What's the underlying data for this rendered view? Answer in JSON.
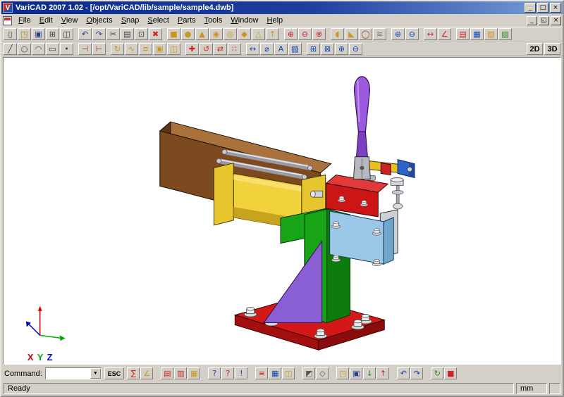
{
  "window": {
    "title": "VariCAD 2007 1.02 - [/opt/VariCAD/lib/sample/sample4.dwb]",
    "app_icon_glyph": "V",
    "controls": [
      {
        "name": "minimize-button",
        "glyph": "_"
      },
      {
        "name": "maximize-button",
        "glyph": "□"
      },
      {
        "name": "close-button",
        "glyph": "×"
      }
    ],
    "mdi_controls": [
      {
        "name": "mdi-minimize-button",
        "glyph": "_"
      },
      {
        "name": "mdi-restore-button",
        "glyph": "◱"
      },
      {
        "name": "mdi-close-button",
        "glyph": "×"
      }
    ]
  },
  "menubar": {
    "items": [
      "File",
      "Edit",
      "View",
      "Objects",
      "Snap",
      "Select",
      "Parts",
      "Tools",
      "Window",
      "Help"
    ]
  },
  "toolbars": {
    "label_2d": "2D",
    "label_3d": "3D",
    "row1": [
      [
        {
          "name": "new-document-icon",
          "glyph": "▯",
          "color": "#404040"
        },
        {
          "name": "open-file-icon",
          "glyph": "◳",
          "color": "#b8860b"
        },
        {
          "name": "save-icon",
          "glyph": "▣",
          "color": "#27408b"
        },
        {
          "name": "print-icon",
          "glyph": "⊞",
          "color": "#404040"
        },
        {
          "name": "print-preview-icon",
          "glyph": "◫",
          "color": "#404040"
        }
      ],
      [
        {
          "name": "undo-icon",
          "glyph": "↶",
          "color": "#1133aa"
        },
        {
          "name": "redo-icon",
          "glyph": "↷",
          "color": "#1133aa"
        },
        {
          "name": "cut-icon",
          "glyph": "✂",
          "color": "#404040"
        },
        {
          "name": "copy-icon",
          "glyph": "▤",
          "color": "#404040"
        },
        {
          "name": "paste-icon",
          "glyph": "⊡",
          "color": "#404040"
        },
        {
          "name": "delete-icon",
          "glyph": "✖",
          "color": "#cc2222"
        }
      ],
      [
        {
          "name": "solid-box-icon",
          "glyph": "■",
          "color": "#c8961e"
        },
        {
          "name": "solid-cylinder-icon",
          "glyph": "●",
          "color": "#c8961e"
        },
        {
          "name": "solid-cone-icon",
          "glyph": "▲",
          "color": "#c8961e"
        },
        {
          "name": "solid-sphere-icon",
          "glyph": "◉",
          "color": "#c8961e"
        },
        {
          "name": "solid-torus-icon",
          "glyph": "◎",
          "color": "#c8961e"
        },
        {
          "name": "solid-prism-icon",
          "glyph": "◆",
          "color": "#c8961e"
        },
        {
          "name": "solid-pyramid-icon",
          "glyph": "△",
          "color": "#c8961e"
        },
        {
          "name": "solid-extrude-icon",
          "glyph": "↑",
          "color": "#c8961e"
        }
      ],
      [
        {
          "name": "boolean-union-icon",
          "glyph": "⊕",
          "color": "#cc2222"
        },
        {
          "name": "boolean-subtract-icon",
          "glyph": "⊖",
          "color": "#cc2222"
        },
        {
          "name": "boolean-intersect-icon",
          "glyph": "⊗",
          "color": "#cc2222"
        }
      ],
      [
        {
          "name": "fillet-icon",
          "glyph": "◖",
          "color": "#c8961e"
        },
        {
          "name": "chamfer-icon",
          "glyph": "◣",
          "color": "#c8961e"
        },
        {
          "name": "hole-icon",
          "glyph": "◯",
          "color": "#8a4b1e"
        },
        {
          "name": "thread-icon",
          "glyph": "≋",
          "color": "#777777"
        }
      ],
      [
        {
          "name": "zoom-in-icon",
          "glyph": "⊕",
          "color": "#1144bb"
        },
        {
          "name": "zoom-out-icon",
          "glyph": "⊖",
          "color": "#1144bb"
        }
      ],
      [
        {
          "name": "measure-distance-icon",
          "glyph": "↔",
          "color": "#cc2222"
        },
        {
          "name": "measure-angle-icon",
          "glyph": "∠",
          "color": "#cc2222"
        }
      ],
      [
        {
          "name": "layers-icon",
          "glyph": "▤",
          "color": "#cc2222"
        },
        {
          "name": "grid-icon",
          "glyph": "▦",
          "color": "#1144bb"
        },
        {
          "name": "snap-settings-icon",
          "glyph": "▧",
          "color": "#c8961e"
        },
        {
          "name": "display-settings-icon",
          "glyph": "▨",
          "color": "#2a8a2a"
        }
      ]
    ],
    "row2": [
      [
        {
          "name": "line-icon",
          "glyph": "╱",
          "color": "#404040"
        },
        {
          "name": "circle-icon",
          "glyph": "○",
          "color": "#404040"
        },
        {
          "name": "arc-icon",
          "glyph": "◠",
          "color": "#404040"
        },
        {
          "name": "rectangle-icon",
          "glyph": "▭",
          "color": "#404040"
        },
        {
          "name": "point-icon",
          "glyph": "•",
          "color": "#404040"
        }
      ],
      [
        {
          "name": "trim-icon",
          "glyph": "⊣",
          "color": "#aa3322"
        },
        {
          "name": "extend-icon",
          "glyph": "⊢",
          "color": "#aa3322"
        }
      ],
      [
        {
          "name": "revolve-icon",
          "glyph": "↻",
          "color": "#c8961e"
        },
        {
          "name": "sweep-icon",
          "glyph": "∿",
          "color": "#c8961e"
        },
        {
          "name": "loft-icon",
          "glyph": "≡",
          "color": "#c8961e"
        },
        {
          "name": "shell-icon",
          "glyph": "▣",
          "color": "#c8961e"
        },
        {
          "name": "rib-icon",
          "glyph": "◫",
          "color": "#c8961e"
        }
      ],
      [
        {
          "name": "move-icon",
          "glyph": "✚",
          "color": "#cc2222"
        },
        {
          "name": "rotate-icon",
          "glyph": "↺",
          "color": "#cc2222"
        },
        {
          "name": "mirror-icon",
          "glyph": "⇄",
          "color": "#cc2222"
        },
        {
          "name": "pattern-icon",
          "glyph": "∷",
          "color": "#cc2222"
        }
      ],
      [
        {
          "name": "dimension-icon",
          "glyph": "↔",
          "color": "#1144bb"
        },
        {
          "name": "diameter-icon",
          "glyph": "⌀",
          "color": "#1144bb"
        },
        {
          "name": "text-icon",
          "glyph": "A",
          "color": "#1144bb"
        },
        {
          "name": "hatch-icon",
          "glyph": "▨",
          "color": "#1144bb"
        }
      ],
      [
        {
          "name": "zoom-window-icon",
          "glyph": "⊞",
          "color": "#1144bb"
        },
        {
          "name": "zoom-all-icon",
          "glyph": "⊠",
          "color": "#1144bb"
        },
        {
          "name": "zoom-in-2-icon",
          "glyph": "⊕",
          "color": "#1144bb"
        },
        {
          "name": "zoom-out-2-icon",
          "glyph": "⊖",
          "color": "#1144bb"
        }
      ]
    ]
  },
  "command_bar": {
    "label": "Command:",
    "esc": "ESC",
    "groups": [
      [
        {
          "name": "calculator-icon",
          "glyph": "∑",
          "color": "#cc2222"
        },
        {
          "name": "angle-tool-icon",
          "glyph": "∠",
          "color": "#c8961e"
        }
      ],
      [
        {
          "name": "attributes-icon",
          "glyph": "▤",
          "color": "#cc2222"
        },
        {
          "name": "layer-tool-icon",
          "glyph": "▥",
          "color": "#cc2222"
        },
        {
          "name": "color-tool-icon",
          "glyph": "▦",
          "color": "#c8961e"
        }
      ],
      [
        {
          "name": "identify-icon",
          "glyph": "?",
          "color": "#1144bb"
        },
        {
          "name": "query-icon",
          "glyph": "?",
          "color": "#cc2222"
        },
        {
          "name": "info-icon",
          "glyph": "!",
          "color": "#1144bb"
        }
      ],
      [
        {
          "name": "list-icon",
          "glyph": "≡",
          "color": "#cc2222"
        },
        {
          "name": "table-icon",
          "glyph": "▦",
          "color": "#1144bb"
        },
        {
          "name": "bom-icon",
          "glyph": "◫",
          "color": "#c8961e"
        }
      ],
      [
        {
          "name": "shaded-view-icon",
          "glyph": "◩",
          "color": "#555555"
        },
        {
          "name": "wireframe-view-icon",
          "glyph": "◇",
          "color": "#555555"
        }
      ],
      [
        {
          "name": "open-library-icon",
          "glyph": "◳",
          "color": "#c8961e"
        },
        {
          "name": "save-part-icon",
          "glyph": "▣",
          "color": "#27408b"
        },
        {
          "name": "import-icon",
          "glyph": "↓",
          "color": "#2a8a2a"
        },
        {
          "name": "export-icon",
          "glyph": "↑",
          "color": "#cc2222"
        }
      ],
      [
        {
          "name": "undo-2-icon",
          "glyph": "↶",
          "color": "#1144bb"
        },
        {
          "name": "redo-2-icon",
          "glyph": "↷",
          "color": "#1144bb"
        }
      ],
      [
        {
          "name": "refresh-icon",
          "glyph": "↻",
          "color": "#2a8a2a"
        },
        {
          "name": "stop-icon",
          "glyph": "■",
          "color": "#cc2222"
        }
      ]
    ]
  },
  "status_bar": {
    "message": "Ready",
    "unit": "mm"
  },
  "axis": {
    "labels": [
      "X",
      "Y",
      "Z"
    ],
    "colors": [
      "#cc0000",
      "#00aa00",
      "#0000cc"
    ]
  },
  "model": {
    "colors": {
      "beam_front": "#7d4a20",
      "beam_top": "#a9713c",
      "beam_end": "#5f3317",
      "flange": "#e6c52e",
      "cyl_body": "#f2d23c",
      "cyl_shadow": "#c8a41e",
      "cyl_highlight": "#f8e070",
      "bracket_green": "#17a517",
      "base_top": "#d41818",
      "base_left": "#a30f0f",
      "base_right": "#8a0c0c",
      "column": "#17a517",
      "column_dark": "#0d7c0d",
      "gusset": "#8a5fd4",
      "plate_gray": "#cdd0d6",
      "plate_blue": "#9cc8e8",
      "plate_blue_dark": "#6fa6cc",
      "bracket_red": "#cc1515",
      "bracket_red_top": "#e23a3a",
      "arm_yellow": "#e8c020",
      "arm_red": "#cc2222",
      "arm_blue": "#2f63cc",
      "arm_blue_dark": "#1d4aa0",
      "handle": "#9b59e0",
      "handle_dark": "#7d3fc0",
      "metal": "#b8b8c0"
    }
  }
}
